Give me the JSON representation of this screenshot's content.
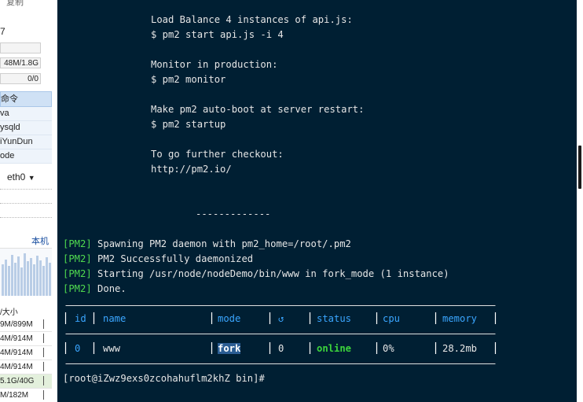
{
  "sidebar": {
    "top_label": "复制",
    "value_7": "7",
    "memory_bar": "48M/1.8G",
    "swap_bar": "0/0",
    "command_header": "命令",
    "processes": [
      "va",
      "ysqld",
      "iYunDun",
      "ode"
    ],
    "interface": "eth0",
    "interface_arrow": "▼",
    "machine_label": "本机",
    "disk_header": "/大小",
    "disks": [
      "9M/899M",
      "4M/914M",
      "4M/914M",
      "4M/914M",
      "5.1G/40G",
      "M/182M"
    ]
  },
  "terminal": {
    "lines": {
      "l1": "Load Balance 4 instances of api.js:",
      "l2": "$ pm2 start api.js -i 4",
      "l3": "Monitor in production:",
      "l4": "$ pm2 monitor",
      "l5": "Make pm2 auto-boot at server restart:",
      "l6": "$ pm2 startup",
      "l7": "To go further checkout:",
      "l8": "http://pm2.io/",
      "sep": "-------------"
    },
    "pm2_tag": "[PM2]",
    "pm2_messages": [
      " Spawning PM2 daemon with pm2_home=/root/.pm2",
      " PM2 Successfully daemonized",
      " Starting /usr/node/nodeDemo/bin/www in fork_mode (1 instance)",
      " Done."
    ],
    "table": {
      "headers": [
        "id",
        "name",
        "mode",
        "↺",
        "status",
        "cpu",
        "memory"
      ],
      "row": {
        "id": "0",
        "name": "www",
        "mode": "fork",
        "restarts": "0",
        "status": "online",
        "cpu": "0%",
        "memory": "28.2mb"
      }
    },
    "prompt": "[root@iZwz9exs0zcohahuflm2khZ bin]#"
  },
  "colors": {
    "terminal_bg": "#001f33",
    "pm2_green": "#4fd94f",
    "header_blue": "#3aa6ff",
    "online_green": "#3cd43c",
    "sidebar_highlight": "#cfe1f5"
  }
}
